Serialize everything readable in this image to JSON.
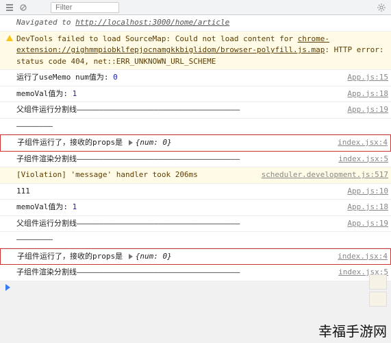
{
  "toolbar": {
    "filter_placeholder": "Filter"
  },
  "nav": {
    "prefix": "Navigated to ",
    "url": "http://localhost:3000/home/article"
  },
  "warn": {
    "line1_a": "DevTools failed to load SourceMap: Could not load content for ",
    "link": "chrome-extension://gighmmpiobklfepjocnamgkkbiglidom/browser-polyfill.js.map",
    "line2": ": HTTP error: status code 404, net::ERR_UNKNOWN_URL_SCHEME"
  },
  "logs": [
    {
      "text_a": "运行了useMemo num值为: ",
      "num": "0",
      "src": "App.js:15"
    },
    {
      "text_a": "memoVal值为: ",
      "num": "1",
      "src": "App.js:18"
    },
    {
      "text_a": "父组件运行分割线",
      "dash": "————————————————————————————————————",
      "src": "App.js:19"
    },
    {
      "cont": "————————"
    },
    {
      "boxed": true,
      "text_a": "子组件运行了，接收的props是 ",
      "obj": "{num: 0}",
      "src": "index.jsx:4"
    },
    {
      "text_a": "子组件渲染分割线",
      "dash": "————————————————————————————————————",
      "src": "index.jsx:5"
    },
    {
      "viol": true,
      "text_a": "[Violation] 'message' handler took 206ms",
      "src": "scheduler.development.js:517"
    },
    {
      "text_a": "111",
      "src": "App.js:10"
    },
    {
      "text_a": "memoVal值为: ",
      "num": "1",
      "src": "App.js:18"
    },
    {
      "text_a": "父组件运行分割线",
      "dash": "————————————————————————————————————",
      "src": "App.js:19"
    },
    {
      "cont": "————————"
    },
    {
      "boxed": true,
      "text_a": "子组件运行了，接收的props是 ",
      "obj": "{num: 0}",
      "src": "index.jsx:4"
    },
    {
      "text_a": "子组件渲染分割线",
      "dash": "————————————————————————————————————",
      "src": "index.jsx:5"
    }
  ],
  "watermark": "幸福手游网"
}
